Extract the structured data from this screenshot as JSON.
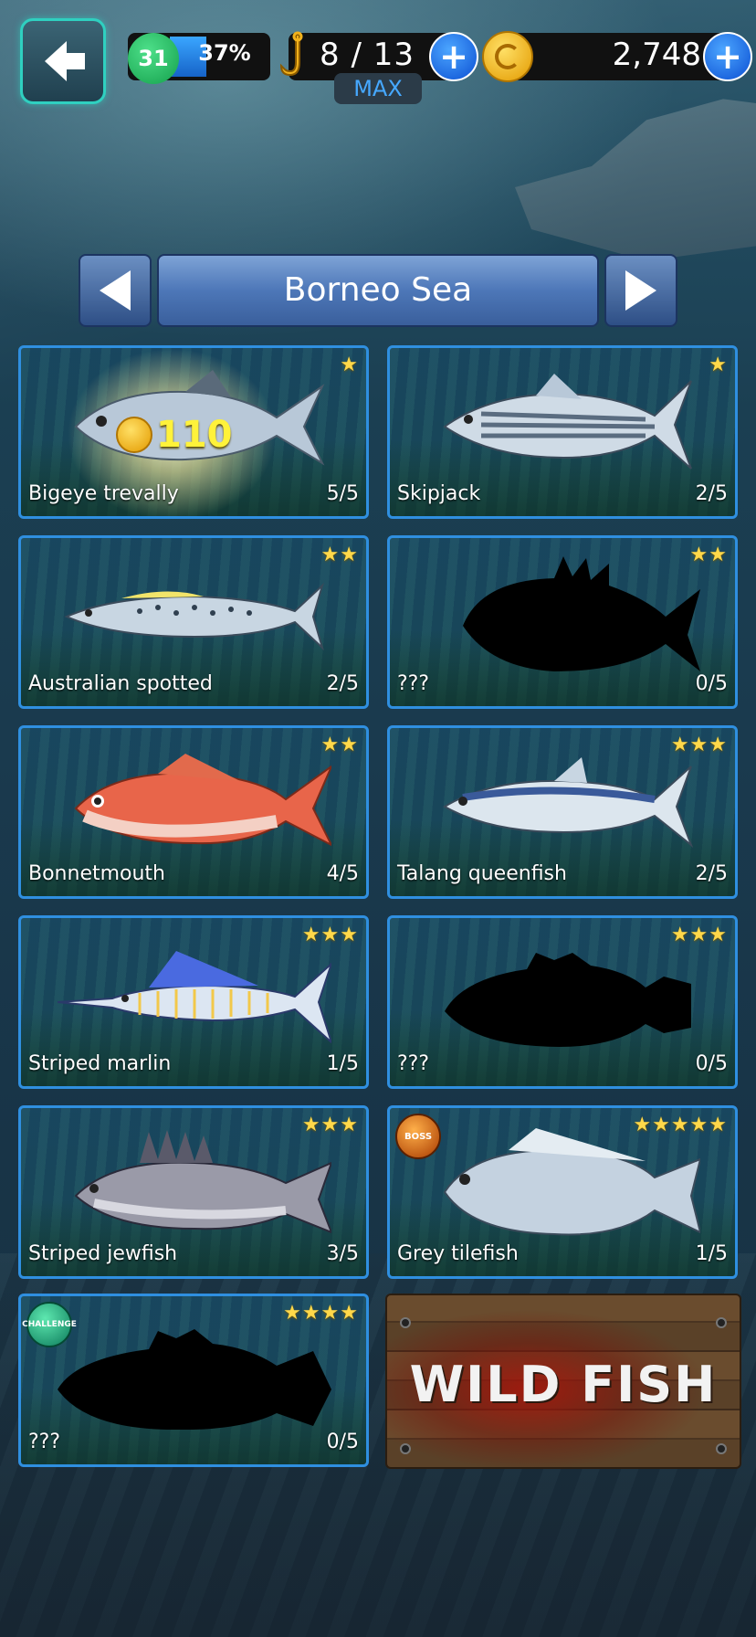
{
  "hud": {
    "level": "31",
    "level_progress": "37%",
    "level_progress_value": 0.37,
    "hooks": "8 / 13",
    "hooks_max_label": "MAX",
    "coins": "2,748",
    "plus_label": "+"
  },
  "region": {
    "title": "Borneo Sea"
  },
  "fish": [
    {
      "name": "Bigeye trevally",
      "count": "5/5",
      "stars": "★",
      "reward": "110",
      "silhouette": false
    },
    {
      "name": "Skipjack",
      "count": "2/5",
      "stars": "★",
      "silhouette": false
    },
    {
      "name": "Australian spotted",
      "count": "2/5",
      "stars": "★★",
      "silhouette": false
    },
    {
      "name": "???",
      "count": "0/5",
      "stars": "★★",
      "silhouette": true
    },
    {
      "name": "Bonnetmouth",
      "count": "4/5",
      "stars": "★★",
      "silhouette": false
    },
    {
      "name": "Talang queenfish",
      "count": "2/5",
      "stars": "★★★",
      "silhouette": false
    },
    {
      "name": "Striped marlin",
      "count": "1/5",
      "stars": "★★★",
      "silhouette": false
    },
    {
      "name": "???",
      "count": "0/5",
      "stars": "★★★",
      "silhouette": true
    },
    {
      "name": "Striped jewfish",
      "count": "3/5",
      "stars": "★★★",
      "silhouette": false
    },
    {
      "name": "Grey tilefish",
      "count": "1/5",
      "stars": "★★★★★",
      "badge": "BOSS",
      "silhouette": false
    },
    {
      "name": "???",
      "count": "0/5",
      "stars": "★★★★",
      "badge": "CHALLENGE",
      "silhouette": true
    }
  ],
  "wild_fish": {
    "label": "WILD FISH"
  },
  "colors": {
    "card_border": "#2f8fe0",
    "star": "#ffd84a",
    "level_badge": "#14a04c",
    "plus_button": "#0b4fd3",
    "max_text": "#46a8ff"
  }
}
